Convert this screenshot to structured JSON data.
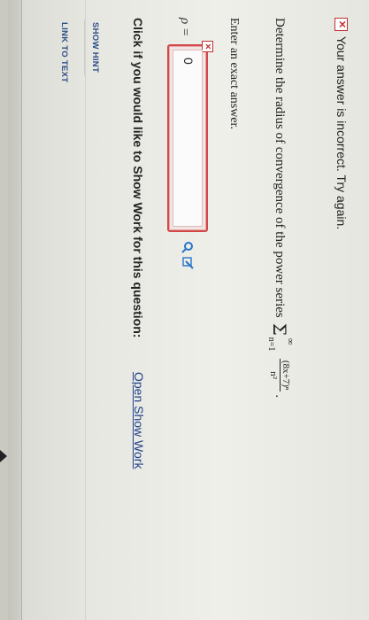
{
  "feedback": {
    "icon": "x-box-icon",
    "text": "Your answer is incorrect.  Try again."
  },
  "question": {
    "prompt": "Determine the radius of convergence of the power series",
    "sum_symbol": "Σ",
    "upper_limit": "∞",
    "lower_limit": "n=1",
    "numerator": "(8x+7)ⁿ",
    "denominator": "n²",
    "end_punct": "."
  },
  "instruction": "Enter an exact answer.",
  "answer": {
    "label": "ρ =",
    "value": "0",
    "status_icon": "x-box-icon"
  },
  "tools": [
    "search-icon",
    "edit-icon"
  ],
  "show_work": {
    "prompt": "Click if you would like to Show Work for this question:",
    "link": "Open Show Work"
  },
  "buttons": {
    "hint": "SHOW HINT",
    "link_to_text": "LINK TO TEXT"
  },
  "colors": {
    "error_red": "#c23030",
    "link_blue": "#1f3f8a",
    "tool_blue": "#2a74c6"
  }
}
